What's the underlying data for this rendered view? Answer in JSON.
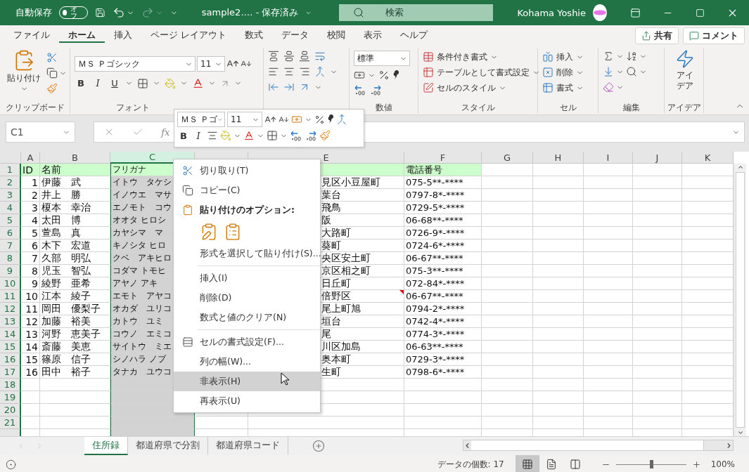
{
  "title_bar": {
    "autosave_label": "自動保存",
    "autosave_toggle": "オフ",
    "autosave_on": false,
    "redo_disabled": true,
    "file_title": "sample2.…  -  保存済み",
    "search_placeholder": "検索",
    "user_name": "Kohama Yoshie"
  },
  "ribbon_tabs": [
    {
      "label": "ファイル",
      "selected": false
    },
    {
      "label": "ホーム",
      "selected": true
    },
    {
      "label": "挿入",
      "selected": false
    },
    {
      "label": "ページ レイアウト",
      "selected": false
    },
    {
      "label": "数式",
      "selected": false
    },
    {
      "label": "データ",
      "selected": false
    },
    {
      "label": "校閲",
      "selected": false
    },
    {
      "label": "表示",
      "selected": false
    },
    {
      "label": "ヘルプ",
      "selected": false
    }
  ],
  "share_button": "共有",
  "comment_button": "コメント",
  "ribbon": {
    "clipboard": {
      "paste": "貼り付け",
      "label": "クリップボード"
    },
    "font": {
      "font_name": "ＭＳ Ｐゴシック",
      "font_size": "11",
      "bold": "B",
      "italic": "I",
      "underline": "U",
      "label": "フォント"
    },
    "number": {
      "format": "標準",
      "label": "数値"
    },
    "styles": {
      "items": [
        "条件付き書式",
        "テーブルとして書式設定",
        "セルのスタイル"
      ],
      "label": "スタイル"
    },
    "cells": {
      "items": [
        "挿入",
        "削除",
        "書式"
      ],
      "label": "セル"
    },
    "editing": {
      "label": "編集"
    },
    "ideas": {
      "button_lines": [
        "アイ",
        "デア"
      ],
      "label": "アイデア"
    }
  },
  "formula_bar": {
    "name_box": "C1",
    "function_label": "fx"
  },
  "mini_toolbar": {
    "font_name": "ＭＳ Ｐゴ",
    "font_size": "11",
    "bold": "B",
    "italic": "I"
  },
  "grid": {
    "columns": [
      {
        "label": "A",
        "selected": false
      },
      {
        "label": "B",
        "selected": false
      },
      {
        "label": "C",
        "selected": true
      },
      {
        "selected": false
      },
      {
        "label": "E",
        "selected": false
      },
      {
        "label": "F",
        "selected": false
      },
      {
        "label": "G",
        "selected": false
      },
      {
        "label": "H",
        "selected": false
      },
      {
        "label": "I",
        "selected": false
      },
      {
        "label": "J",
        "selected": false
      },
      {
        "label": "K",
        "selected": false
      }
    ],
    "rows": [
      {
        "number": "1",
        "kind": "header",
        "a": "ID",
        "b": "名前",
        "c": "フリガナ",
        "f": "電話番号",
        "e_comment": false
      },
      {
        "number": "2",
        "kind": "data",
        "a": "1",
        "b": "伊藤　武",
        "c": "イトウ　タケシ",
        "e": "見区小豆屋町",
        "f": "075-5**-****",
        "e_comment": false
      },
      {
        "number": "3",
        "kind": "data",
        "a": "2",
        "b": "井上　勝",
        "c": "イノウエ　マサ",
        "e": "葉台",
        "f": "0797-8*-****",
        "e_comment": false
      },
      {
        "number": "4",
        "kind": "data",
        "a": "3",
        "b": "榎本　幸治",
        "c": "エノモト　コウ",
        "e": "飛鳥",
        "f": "0729-5*-****",
        "e_comment": false
      },
      {
        "number": "5",
        "kind": "data",
        "a": "4",
        "b": "太田　博",
        "c": "オオタ ヒロシ",
        "e": "阪",
        "f": "06-68**-****",
        "e_comment": false
      },
      {
        "number": "6",
        "kind": "data",
        "a": "5",
        "b": "萱島　真",
        "c": "カヤシマ　マ",
        "e": "大路町",
        "f": "0726-9*-****",
        "e_comment": false
      },
      {
        "number": "7",
        "kind": "data",
        "a": "6",
        "b": "木下　宏道",
        "c": "キノシタ ヒロ",
        "e": "葵町",
        "f": "0724-6*-****",
        "e_comment": false
      },
      {
        "number": "8",
        "kind": "data",
        "a": "7",
        "b": "久部　明弘",
        "c": "クベ　アキヒロ",
        "e": "央区安土町",
        "f": "06-67**-****",
        "e_comment": false
      },
      {
        "number": "9",
        "kind": "data",
        "a": "8",
        "b": "児玉　智弘",
        "c": "コダマ トモヒ",
        "e": "京区相之町",
        "f": "075-3**-****",
        "e_comment": false
      },
      {
        "number": "10",
        "kind": "data",
        "a": "9",
        "b": "綾野　亜希",
        "c": "アヤノ アキ",
        "e": "日丘町",
        "f": "072-84*-****",
        "e_comment": false
      },
      {
        "number": "11",
        "kind": "data",
        "a": "10",
        "b": "江本　綾子",
        "c": "エモト　アヤコ",
        "e": "倍野区",
        "f": "06-67**-****",
        "e_comment": true
      },
      {
        "number": "12",
        "kind": "data",
        "a": "11",
        "b": "岡田　優梨子",
        "c": "オカダ　ユリコ",
        "e": "尾上町旭",
        "f": "0794-2*-****",
        "e_comment": false
      },
      {
        "number": "13",
        "kind": "data",
        "a": "12",
        "b": "加藤　裕美",
        "c": "カトウ　ユミ",
        "e": "垣台",
        "f": "0742-4*-****",
        "e_comment": false
      },
      {
        "number": "14",
        "kind": "data",
        "a": "13",
        "b": "河野　恵美子",
        "c": "コウノ　エミコ",
        "e": "尾",
        "f": "0774-3*-****",
        "e_comment": false
      },
      {
        "number": "15",
        "kind": "data",
        "a": "14",
        "b": "斎藤　美恵",
        "c": "サイトウ　ミエ",
        "e": "川区加島",
        "f": "06-63**-****",
        "e_comment": false
      },
      {
        "number": "16",
        "kind": "data",
        "a": "15",
        "b": "篠原　信子",
        "c": "シノハラ ノブ",
        "e": "奥本町",
        "f": "0729-3*-****",
        "e_comment": false
      },
      {
        "number": "17",
        "kind": "data",
        "a": "16",
        "b": "田中　裕子",
        "c": "タナカ　ユウコ",
        "e": "生町",
        "f": "0798-6*-****",
        "e_comment": false
      },
      {
        "number": "18",
        "kind": "data",
        "e_comment": false
      },
      {
        "number": "19",
        "kind": "data",
        "e_comment": false
      },
      {
        "number": "20",
        "kind": "data",
        "e_comment": false
      },
      {
        "number": "21",
        "kind": "data",
        "e_comment": false
      }
    ]
  },
  "context_menu": {
    "items": [
      {
        "kind": "cut",
        "label": "切り取り(T)",
        "selected": false
      },
      {
        "kind": "copy",
        "label": "コピー(C)",
        "selected": false
      },
      {
        "kind": "heading",
        "label": "貼り付けのオプション:"
      },
      {
        "kind": "paste_icons"
      },
      {
        "kind": "command",
        "label": "形式を選択して貼り付け(S)...",
        "selected": false
      },
      {
        "kind": "separator"
      },
      {
        "kind": "command",
        "label": "挿入(I)",
        "selected": false
      },
      {
        "kind": "command",
        "label": "削除(D)",
        "selected": false
      },
      {
        "kind": "command",
        "label": "数式と値のクリア(N)",
        "selected": false
      },
      {
        "kind": "separator"
      },
      {
        "kind": "format",
        "label": "セルの書式設定(F)...",
        "selected": false
      },
      {
        "kind": "command",
        "label": "列の幅(W)...",
        "selected": false
      },
      {
        "kind": "command",
        "label": "非表示(H)",
        "selected": true
      },
      {
        "kind": "command",
        "label": "再表示(U)",
        "selected": false
      }
    ]
  },
  "sheet_tabs": [
    {
      "label": "住所録",
      "selected": true
    },
    {
      "label": "都道府県で分割",
      "selected": false
    },
    {
      "label": "都道府県コード",
      "selected": false
    }
  ],
  "status_bar": {
    "count": "データの個数: 17",
    "views": [
      {
        "kind": "normal",
        "selected": true
      },
      {
        "kind": "page_layout",
        "selected": false
      },
      {
        "kind": "page_break",
        "selected": false
      }
    ],
    "zoom_slider": {
      "level": 0.5
    },
    "zoom": "100%"
  }
}
